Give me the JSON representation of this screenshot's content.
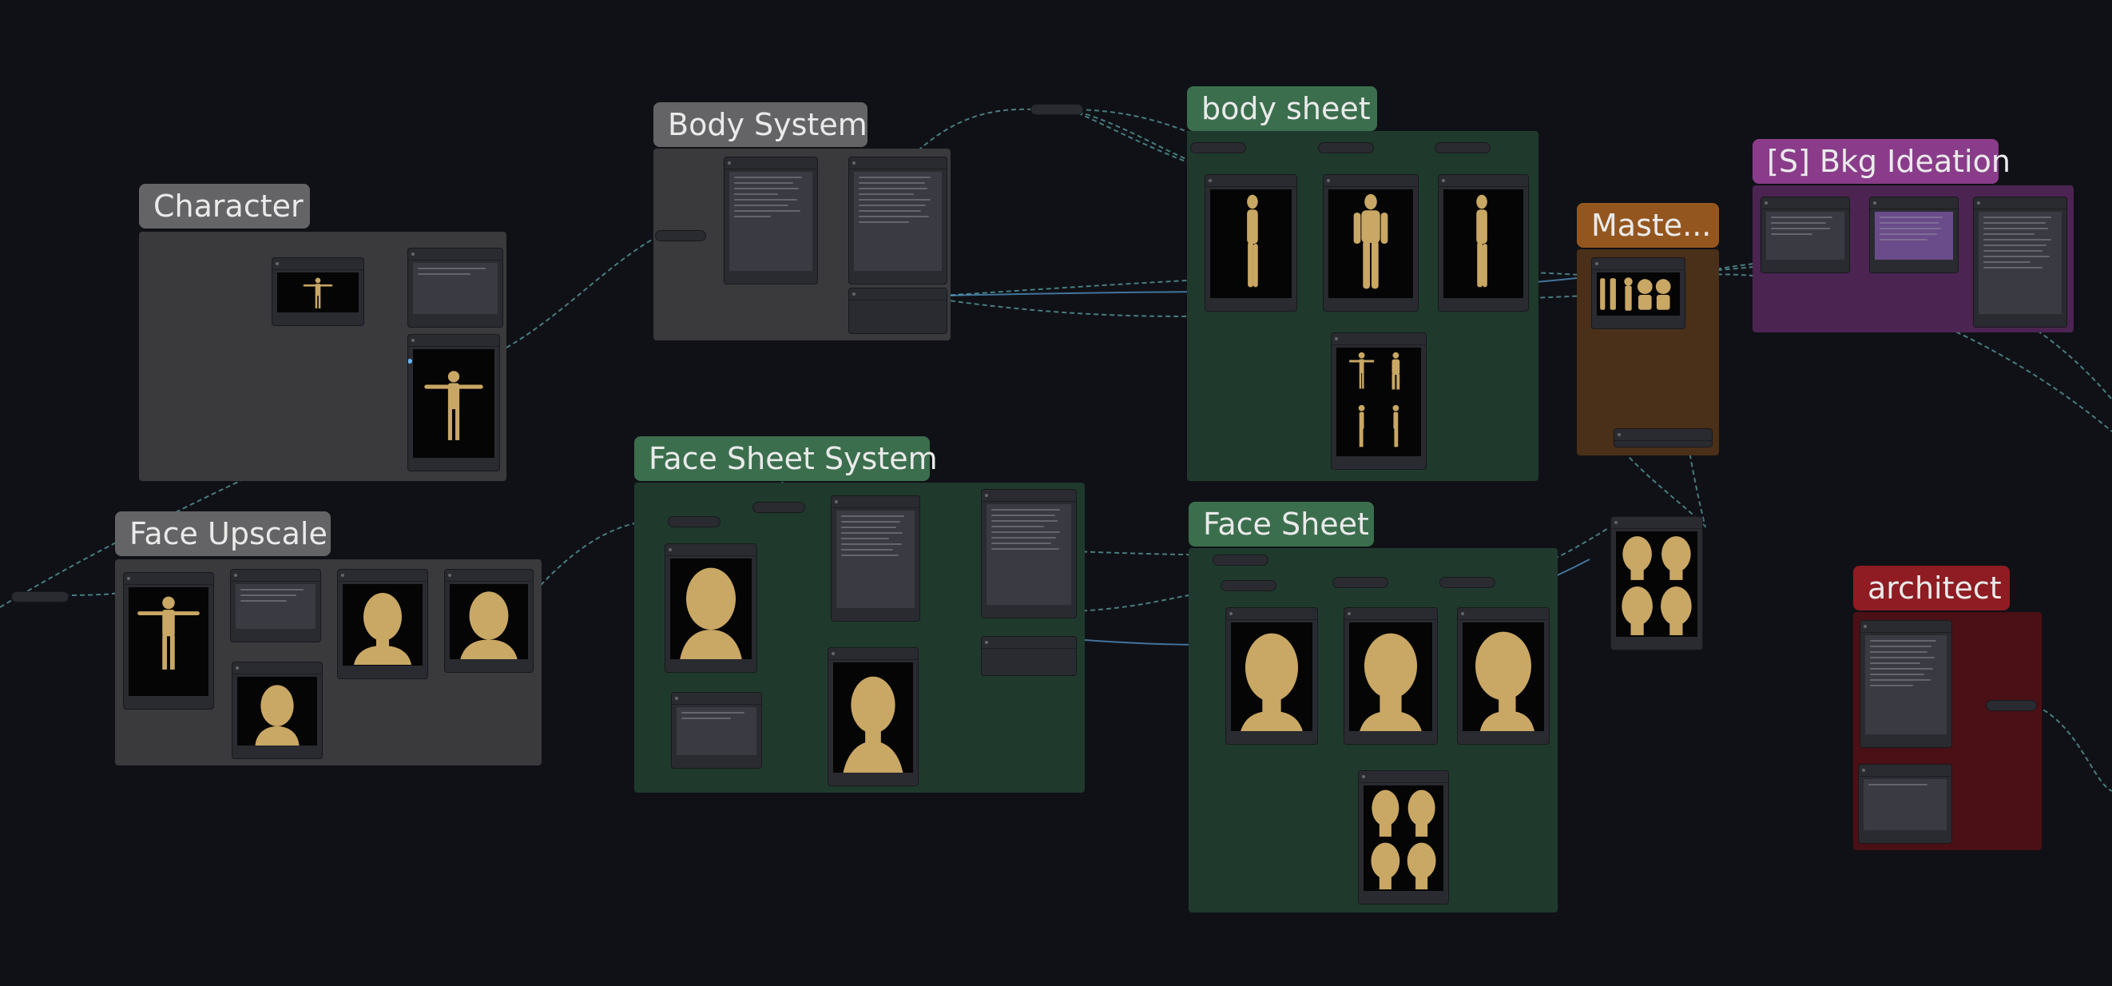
{
  "canvas": {
    "background": "#101116",
    "wire_color": "#5f9ea0"
  },
  "groups": [
    {
      "id": "character",
      "title": "Character",
      "title_color": "#646466",
      "body_color": "#3a3a3d"
    },
    {
      "id": "body-system",
      "title": "Body System",
      "title_color": "#646466",
      "body_color": "#3a3a3d"
    },
    {
      "id": "body-sheet",
      "title": "body sheet",
      "title_color": "#3b6e4d",
      "body_color": "#1f3a2d"
    },
    {
      "id": "master",
      "title": "Maste...",
      "title_color": "#94561f",
      "body_color": "#4a3018"
    },
    {
      "id": "bkg-ideation",
      "title": "[S] Bkg Ideation",
      "title_color": "#8a3c8a",
      "body_color": "#4b2451"
    },
    {
      "id": "face-upscale",
      "title": "Face Upscale",
      "title_color": "#646466",
      "body_color": "#3a3a3d"
    },
    {
      "id": "face-sheet-system",
      "title": "Face Sheet System",
      "title_color": "#3b6e4d",
      "body_color": "#1f3a2d"
    },
    {
      "id": "face-sheet",
      "title": "Face Sheet",
      "title_color": "#3b6e4d",
      "body_color": "#1f3a2d"
    },
    {
      "id": "architect",
      "title": "architect",
      "title_color": "#8e1c22",
      "body_color": "#4a1015"
    }
  ],
  "figure_color": "#c9a764",
  "port_colors": {
    "image": "#64b5f6",
    "text": "#9ccc65",
    "generic": "#8aa0b8"
  }
}
